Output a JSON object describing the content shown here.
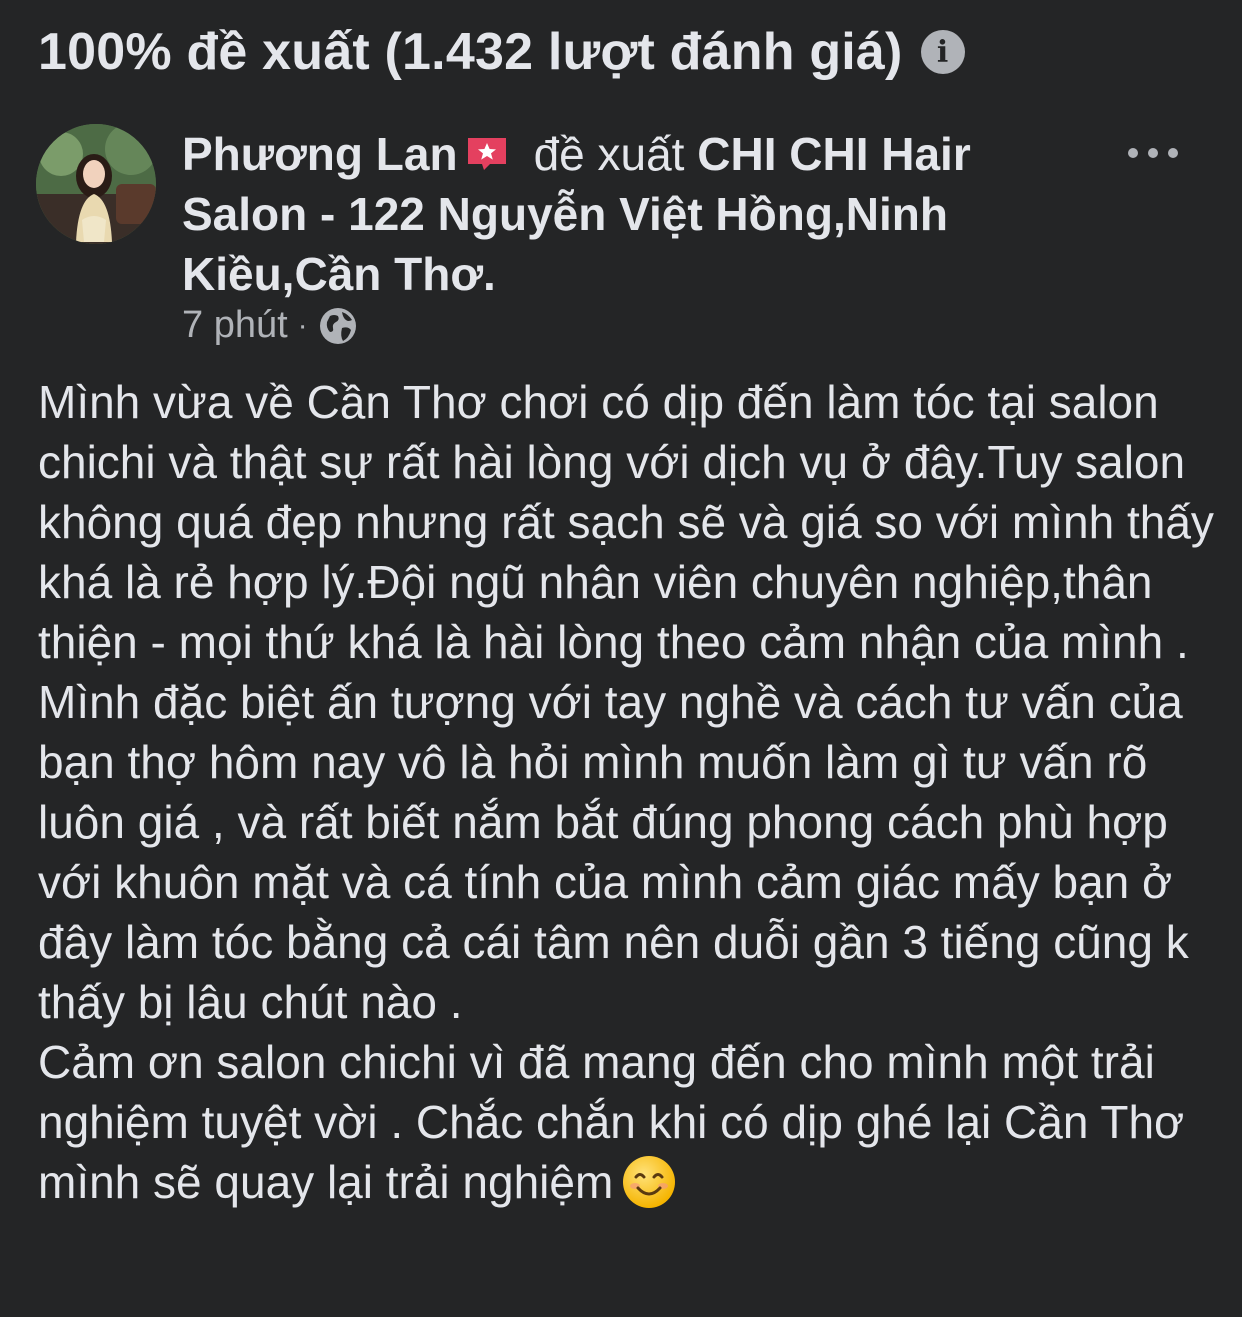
{
  "summary": {
    "text": "100% đề xuất (1.432 lượt đánh giá)",
    "info_icon": "info-icon"
  },
  "review": {
    "author": "Phương Lan",
    "badge_icon": "top-fan-star-badge-icon",
    "action": "đề xuất",
    "page_name": "CHI CHI Hair Salon - 122 Nguyễn Việt Hồng,Ninh Kiều,Cần Thơ.",
    "time": "7 phút",
    "separator": "·",
    "privacy_icon": "globe-icon",
    "more_icon": "more-options-icon",
    "paragraphs": [
      "Mình vừa về Cần Thơ chơi có dịp đến làm tóc tại salon chichi và thật sự rất hài lòng với dịch vụ ở đây.Tuy salon không quá đẹp nhưng rất sạch sẽ và giá so với mình thấy khá là rẻ hợp lý.Đội ngũ nhân viên chuyên nghiệp,thân thiện - mọi thứ khá là hài lòng theo cảm nhận của mình .",
      "Mình đặc biệt ấn tượng với tay nghề và cách tư vấn của bạn thợ hôm nay vô là hỏi mình muốn làm gì tư vấn rõ luôn giá , và rất biết nắm bắt đúng phong cách phù hợp với khuôn mặt và cá tính của mình cảm giác mấy bạn ở đây làm tóc bằng cả cái tâm nên duỗi gần 3 tiếng cũng k thấy bị lâu chút nào .",
      "Cảm ơn salon chichi vì đã mang đến cho mình một trải nghiệm tuyệt vời . Chắc chắn khi có dịp ghé lại Cần Thơ mình sẽ quay lại trải nghiệm"
    ],
    "emoji_icon": "smiling-face-emoji-icon"
  },
  "colors": {
    "background": "#242526",
    "text_primary": "#e4e6eb",
    "text_secondary": "#b0b3b8",
    "badge_pink": "#e4405f"
  }
}
